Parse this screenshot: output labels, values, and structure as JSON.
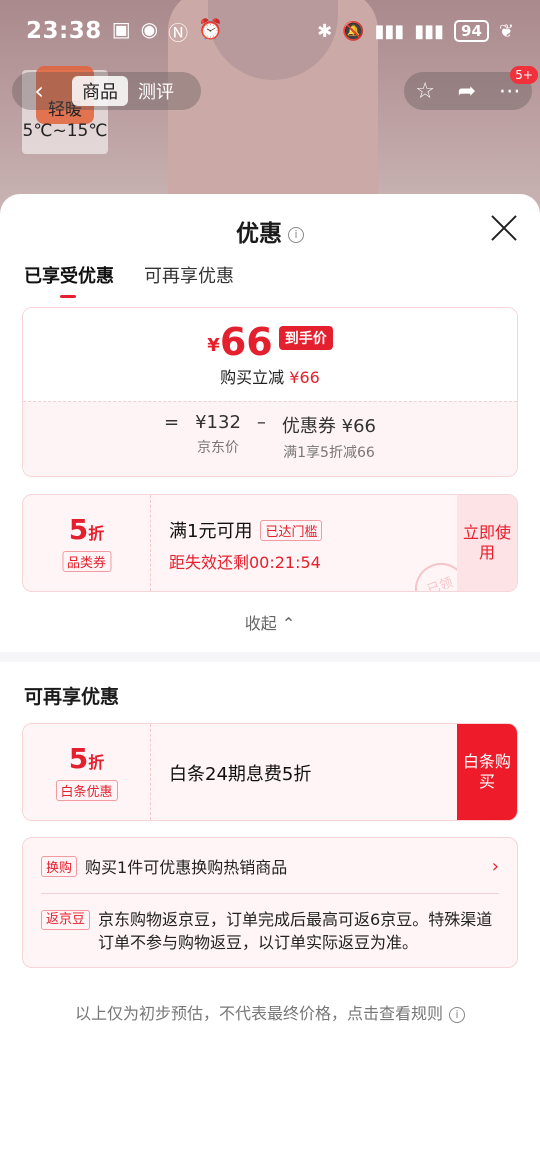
{
  "status_bar": {
    "time": "23:38",
    "battery": "94"
  },
  "weather": {
    "label": "轻暖",
    "range": "5℃~15℃"
  },
  "nav": {
    "back_icon": "‹",
    "tabs": [
      "商品",
      "测评"
    ],
    "cart_badge": "5+"
  },
  "sheet": {
    "title": "优惠",
    "info_glyph": "i",
    "sub_tabs": [
      "已享受优惠",
      "可再享优惠"
    ]
  },
  "summary": {
    "currency": "¥",
    "final_price": "66",
    "final_tag": "到手价",
    "reduce_label": "购买立减",
    "reduce_value": "¥66",
    "eq": "=",
    "jd_price": "¥132",
    "jd_price_label": "京东价",
    "minus": "–",
    "coupon_value": "优惠券 ¥66",
    "coupon_rule": "满1享5折减66"
  },
  "coupon_category": {
    "discount": "5",
    "unit": "折",
    "label": "品类券",
    "title": "满1元可用",
    "threshold": "已达门槛",
    "countdown": "距失效还剩00:21:54",
    "action": "立即使用",
    "stamp": "已领"
  },
  "collapse": {
    "label": "收起 ⌃"
  },
  "more_section": {
    "title": "可再享优惠"
  },
  "coupon_baitiao": {
    "discount": "5",
    "unit": "折",
    "label": "白条优惠",
    "title": "白条24期息费5折",
    "action": "白条购买"
  },
  "extra": {
    "exchange_tag": "换购",
    "exchange_text": "购买1件可优惠换购热销商品",
    "arrow": "›",
    "bean_tag": "返京豆",
    "bean_text": "京东购物返京豆，订单完成后最高可返6京豆。特殊渠道订单不参与购物返豆，以订单实际返豆为准。"
  },
  "footnote": {
    "text": "以上仅为初步预估，不代表最终价格，点击查看规则"
  }
}
